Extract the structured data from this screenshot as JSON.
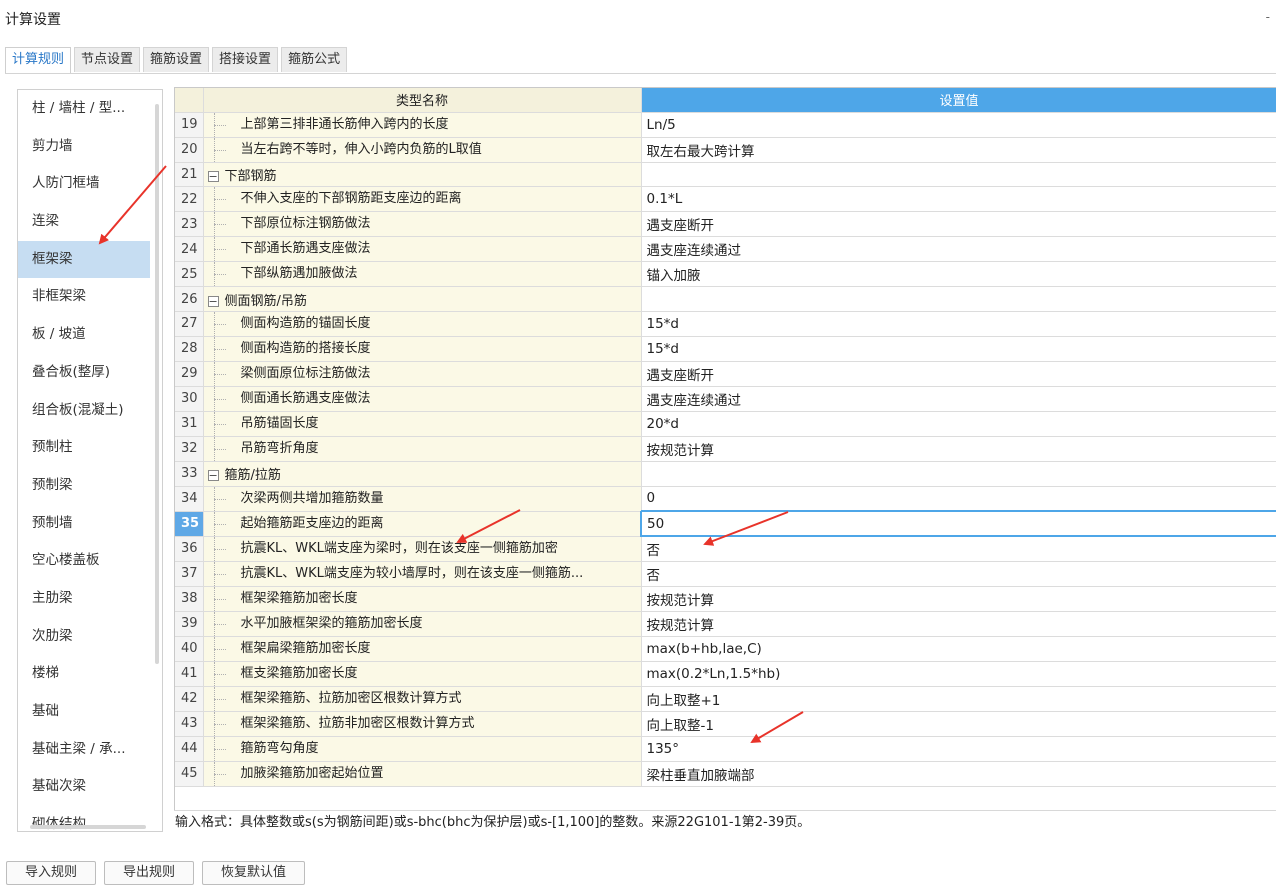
{
  "window": {
    "title": "计算设置",
    "minimize": "-"
  },
  "tabs": [
    "计算规则",
    "节点设置",
    "箍筋设置",
    "搭接设置",
    "箍筋公式"
  ],
  "active_tab": 0,
  "sidebar": {
    "items": [
      "柱 / 墙柱 / 型...",
      "剪力墙",
      "人防门框墙",
      "连梁",
      "框架梁",
      "非框架梁",
      "板 / 坡道",
      "叠合板(整厚)",
      "组合板(混凝土)",
      "预制柱",
      "预制梁",
      "预制墙",
      "空心楼盖板",
      "主肋梁",
      "次肋梁",
      "楼梯",
      "基础",
      "基础主梁 / 承...",
      "基础次梁",
      "砌体结构"
    ],
    "selected": 4
  },
  "grid": {
    "headers": {
      "name": "类型名称",
      "value": "设置值"
    },
    "rows": [
      {
        "no": "19",
        "name": "上部第三排非通长筋伸入跨内的长度",
        "value": "Ln/5",
        "group": false
      },
      {
        "no": "20",
        "name": "当左右跨不等时，伸入小跨内负筋的L取值",
        "value": "取左右最大跨计算",
        "group": false
      },
      {
        "no": "21",
        "name": "下部钢筋",
        "value": "",
        "group": true
      },
      {
        "no": "22",
        "name": "不伸入支座的下部钢筋距支座边的距离",
        "value": "0.1*L",
        "group": false
      },
      {
        "no": "23",
        "name": "下部原位标注钢筋做法",
        "value": "遇支座断开",
        "group": false
      },
      {
        "no": "24",
        "name": "下部通长筋遇支座做法",
        "value": "遇支座连续通过",
        "group": false
      },
      {
        "no": "25",
        "name": "下部纵筋遇加腋做法",
        "value": "锚入加腋",
        "group": false
      },
      {
        "no": "26",
        "name": "侧面钢筋/吊筋",
        "value": "",
        "group": true
      },
      {
        "no": "27",
        "name": "侧面构造筋的锚固长度",
        "value": "15*d",
        "group": false
      },
      {
        "no": "28",
        "name": "侧面构造筋的搭接长度",
        "value": "15*d",
        "group": false
      },
      {
        "no": "29",
        "name": "梁侧面原位标注筋做法",
        "value": "遇支座断开",
        "group": false
      },
      {
        "no": "30",
        "name": "侧面通长筋遇支座做法",
        "value": "遇支座连续通过",
        "group": false
      },
      {
        "no": "31",
        "name": "吊筋锚固长度",
        "value": "20*d",
        "group": false
      },
      {
        "no": "32",
        "name": "吊筋弯折角度",
        "value": "按规范计算",
        "group": false
      },
      {
        "no": "33",
        "name": "箍筋/拉筋",
        "value": "",
        "group": true
      },
      {
        "no": "34",
        "name": "次梁两侧共增加箍筋数量",
        "value": "0",
        "group": false
      },
      {
        "no": "35",
        "name": "起始箍筋距支座边的距离",
        "value": "50",
        "group": false,
        "current": true
      },
      {
        "no": "36",
        "name": "抗震KL、WKL端支座为梁时，则在该支座一侧箍筋加密",
        "value": "否",
        "group": false
      },
      {
        "no": "37",
        "name": "抗震KL、WKL端支座为较小墙厚时，则在该支座一侧箍筋...",
        "value": "否",
        "group": false
      },
      {
        "no": "38",
        "name": "框架梁箍筋加密长度",
        "value": "按规范计算",
        "group": false
      },
      {
        "no": "39",
        "name": "水平加腋框架梁的箍筋加密长度",
        "value": "按规范计算",
        "group": false
      },
      {
        "no": "40",
        "name": "框架扁梁箍筋加密长度",
        "value": "max(b+hb,lae,C)",
        "group": false
      },
      {
        "no": "41",
        "name": "框支梁箍筋加密长度",
        "value": "max(0.2*Ln,1.5*hb)",
        "group": false
      },
      {
        "no": "42",
        "name": "框架梁箍筋、拉筋加密区根数计算方式",
        "value": "向上取整+1",
        "group": false
      },
      {
        "no": "43",
        "name": "框架梁箍筋、拉筋非加密区根数计算方式",
        "value": "向上取整-1",
        "group": false
      },
      {
        "no": "44",
        "name": "箍筋弯勾角度",
        "value": "135°",
        "group": false
      },
      {
        "no": "45",
        "name": "加腋梁箍筋加密起始位置",
        "value": "梁柱垂直加腋端部",
        "group": false
      }
    ]
  },
  "hint": "输入格式：具体整数或s(s为钢筋间距)或s-bhc(bhc为保护层)或s-[1,100]的整数。来源22G101-1第2-39页。",
  "buttons": [
    "导入规则",
    "导出规则",
    "恢复默认值"
  ],
  "colors": {
    "accent": "#4ea6e8",
    "selected_item": "#c6ddf2",
    "annotation_arrow": "#e8332a",
    "name_column_bg": "#fbf9e6"
  }
}
